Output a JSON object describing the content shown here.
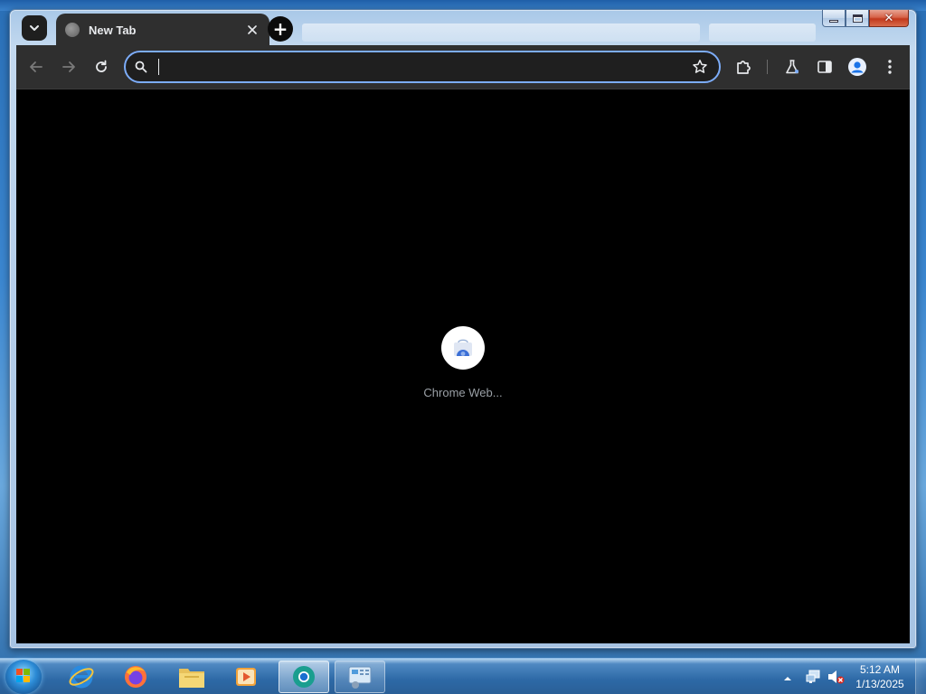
{
  "browser": {
    "tab": {
      "title": "New Tab"
    },
    "newtab_symbol": "+",
    "omnibox": {
      "value": "",
      "placeholder": ""
    }
  },
  "new_tab_page": {
    "shortcuts": [
      {
        "label": "Chrome Web..."
      }
    ]
  },
  "taskbar": {
    "apps": [
      "internet-explorer",
      "firefox",
      "file-explorer",
      "media-player",
      "chrome",
      "control-panel"
    ],
    "clock": {
      "time": "5:12 AM",
      "date": "1/13/2025"
    }
  },
  "colors": {
    "toolbar_bg": "#2f2f2f",
    "omnibox_focus": "#7cacf8",
    "page_bg": "#000000"
  }
}
